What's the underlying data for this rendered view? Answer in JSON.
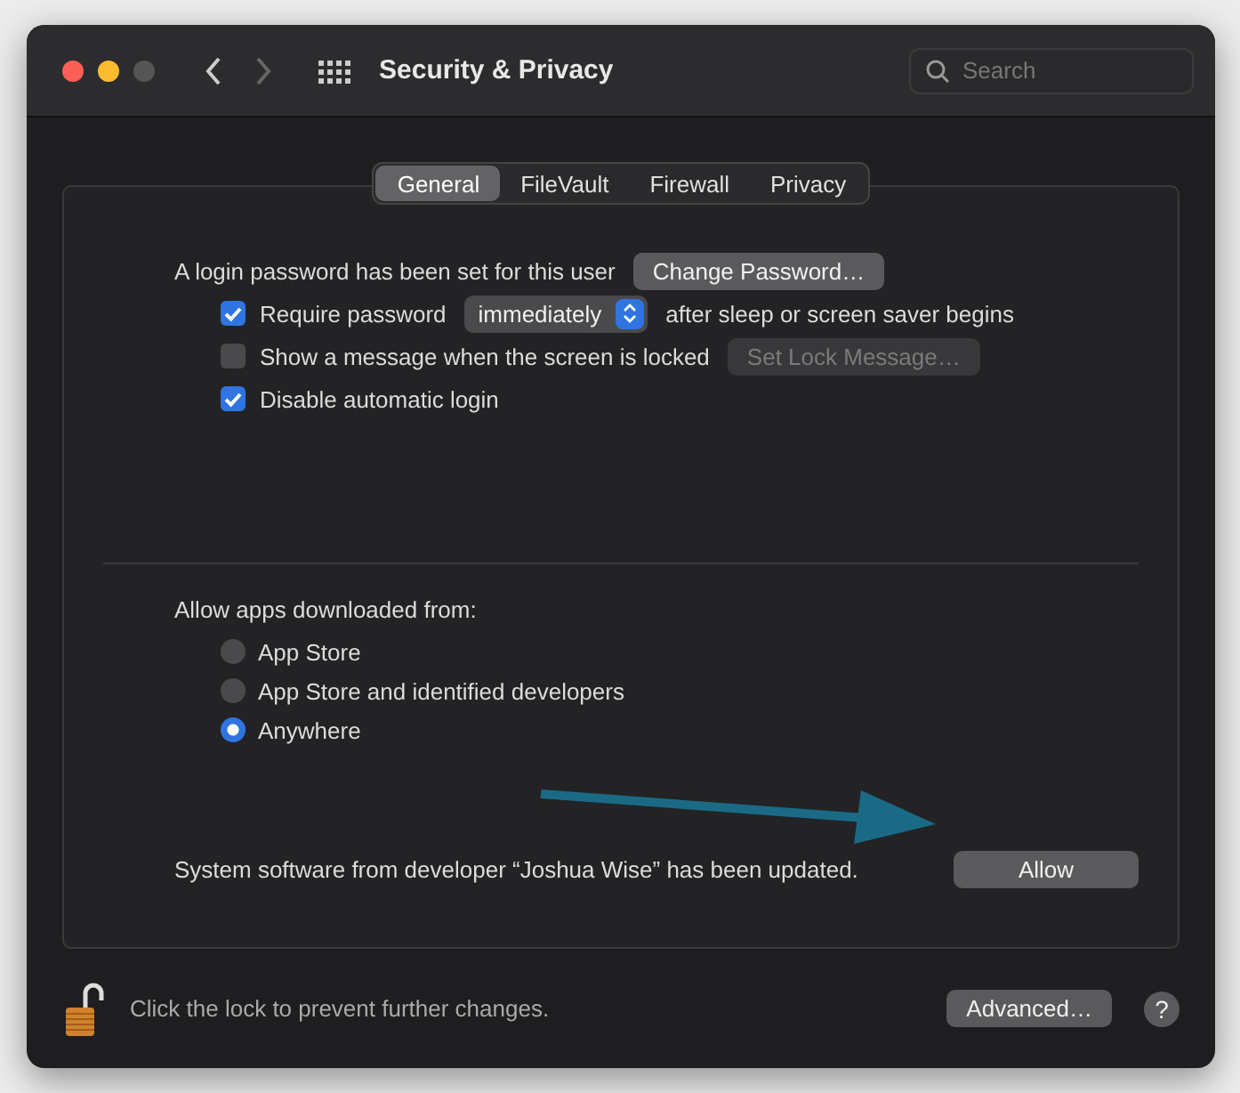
{
  "window": {
    "title": "Security & Privacy",
    "search": {
      "placeholder": "Search"
    }
  },
  "tabs": [
    {
      "label": "General",
      "selected": true
    },
    {
      "label": "FileVault",
      "selected": false
    },
    {
      "label": "Firewall",
      "selected": false
    },
    {
      "label": "Privacy",
      "selected": false
    }
  ],
  "general": {
    "password_label": "A login password has been set for this user",
    "change_password_button": "Change Password…",
    "options": [
      {
        "kind": "popup",
        "checked": true,
        "label": "Require password",
        "popup": "immediately",
        "suffix": "after sleep or screen saver begins"
      },
      {
        "kind": "button",
        "checked": false,
        "label": "Show a message when the screen is locked",
        "button": {
          "label": "Set Lock Message…",
          "disabled": true
        }
      },
      {
        "kind": "plain",
        "checked": true,
        "label": "Disable automatic login"
      }
    ]
  },
  "allow_apps": {
    "label": "Allow apps downloaded from:",
    "options": [
      {
        "label": "App Store",
        "selected": false
      },
      {
        "label": "App Store and identified developers",
        "selected": false
      },
      {
        "label": "Anywhere",
        "selected": true
      }
    ]
  },
  "system_software": {
    "message": "System software from developer “Joshua Wise” has been updated.",
    "button": "Allow"
  },
  "footer": {
    "locked": false,
    "lock_label": "Click the lock to prevent further changes.",
    "advanced_button": "Advanced…",
    "help_button": "?"
  }
}
